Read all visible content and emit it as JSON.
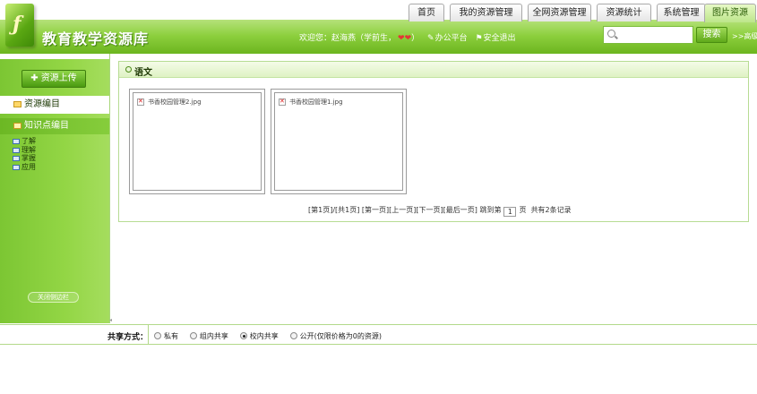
{
  "header": {
    "logo_glyph": "ƒ",
    "site_title": "教育教学资源库",
    "welcome_prefix": "欢迎您：",
    "user_name": "赵海燕",
    "user_role": "（学前生，",
    "hearts": "❤❤",
    "role_close": "）",
    "office_link": "办公平台",
    "logout_link": "安全退出",
    "search_placeholder": "",
    "search_button": "搜索",
    "advanced_link": ">>高级"
  },
  "nav_tabs": [
    {
      "label": "首页"
    },
    {
      "label": "我的资源管理"
    },
    {
      "label": "全网资源管理"
    },
    {
      "label": "资源统计"
    },
    {
      "label": "系统管理"
    },
    {
      "label": "图片资源"
    }
  ],
  "sidebar": {
    "upload_button": "资源上传",
    "resource_edit": "资源编目",
    "knowledge_edit": "知识点编目",
    "tree_items": [
      "了解",
      "理解",
      "掌握",
      "应用"
    ],
    "collapse_button": "关闭侧边栏"
  },
  "panel": {
    "title": "语文",
    "cards": [
      {
        "label": "书香校园管理2.jpg"
      },
      {
        "label": "书香校园管理1.jpg"
      }
    ],
    "pager": {
      "current": "[第1页]",
      "total": "/[共1页]",
      "first": "[第一页]",
      "prev": "[上一页]",
      "next": "[下一页]",
      "last": "[最后一页]",
      "jump_label": "跳到第",
      "page_value": "1",
      "page_suffix": "页",
      "record_count": "共有2条记录"
    }
  },
  "share": {
    "label": "共享方式：",
    "options": [
      {
        "label": "私有",
        "checked": false
      },
      {
        "label": "组内共享",
        "checked": false
      },
      {
        "label": "校内共享",
        "checked": true
      },
      {
        "label": "公开(仅限价格为0的资源)",
        "checked": false
      }
    ]
  }
}
